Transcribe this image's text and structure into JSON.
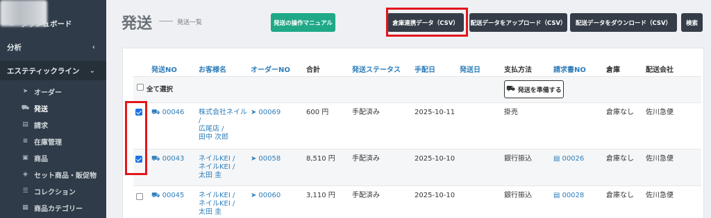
{
  "sidebar": {
    "dashboard": "ダッシュボード",
    "analysis": "分析",
    "section": "エステティックライン",
    "items": [
      {
        "label": "オーダー",
        "icon": "paper-plane-icon"
      },
      {
        "label": "発送",
        "icon": "truck-icon"
      },
      {
        "label": "請求",
        "icon": "document-icon"
      },
      {
        "label": "在庫管理",
        "icon": "database-icon"
      },
      {
        "label": "商品",
        "icon": "box-icon"
      },
      {
        "label": "セット商品・販促物",
        "icon": "layers-icon"
      },
      {
        "label": "コレクション",
        "icon": "list-icon"
      },
      {
        "label": "商品カテゴリー",
        "icon": "category-icon"
      }
    ]
  },
  "header": {
    "title": "発送",
    "subtitle": "発送一覧",
    "buttons": {
      "manual": "発送の操作マニュアル",
      "csv": "倉庫連携データ（CSV）",
      "upload": "配送データをアップロード（CSV）",
      "download": "配送データをダウンロード（CSV）",
      "search": "検索"
    }
  },
  "table": {
    "headers": {
      "ship_no": "発送NO",
      "customer": "お客様名",
      "order_no": "オーダーNO",
      "total": "合計",
      "status": "発送ステータス",
      "arrange_date": "手配日",
      "ship_date": "発送日",
      "payment": "支払方法",
      "invoice_no": "請求書NO",
      "warehouse": "倉庫",
      "carrier": "配送会社"
    },
    "select_all": "全て選択",
    "prepare_button": "発送を準備する",
    "rows": [
      {
        "checked": true,
        "ship_no": "00046",
        "customer": [
          "株式会社ネイル",
          "/",
          "広尾店 /",
          "田中 次郎"
        ],
        "order_no": "00069",
        "total": "600 円",
        "status": "手配済み",
        "arrange_date": "2025-10-11",
        "ship_date": "",
        "payment": "掛売",
        "invoice_no": "",
        "warehouse": "倉庫なし",
        "carrier": "佐川急便"
      },
      {
        "checked": true,
        "ship_no": "00043",
        "customer": [
          "ネイルKEI /",
          "ネイルKEI /",
          "太田 圭"
        ],
        "order_no": "00058",
        "total": "8,510 円",
        "status": "手配済み",
        "arrange_date": "2025-10-10",
        "ship_date": "",
        "payment": "銀行振込",
        "invoice_no": "00026",
        "warehouse": "倉庫なし",
        "carrier": "佐川急便"
      },
      {
        "checked": false,
        "ship_no": "00045",
        "customer": [
          "ネイルKEI /",
          "ネイルKEI /",
          "太田 圭"
        ],
        "order_no": "00060",
        "total": "3,110 円",
        "status": "手配済み",
        "arrange_date": "2025-10-10",
        "ship_date": "",
        "payment": "銀行振込",
        "invoice_no": "00028",
        "warehouse": "倉庫なし",
        "carrier": "佐川急便"
      }
    ]
  },
  "colors": {
    "sidebar_bg": "#2f3b48",
    "accent_green": "#1fa987",
    "dark_button": "#343d48",
    "link_blue": "#2c7dbb",
    "highlight_red": "#e3141b"
  }
}
